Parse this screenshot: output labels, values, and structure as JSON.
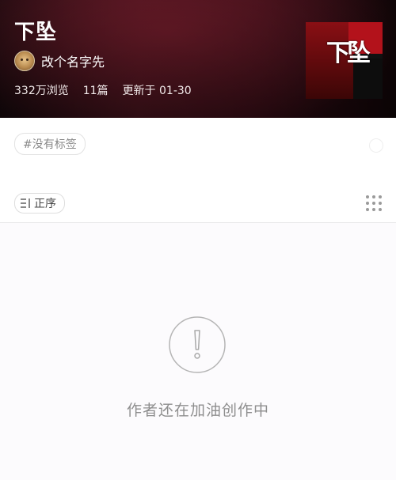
{
  "header": {
    "title": "下坠",
    "author": "改个名字先",
    "stats": {
      "views": "332万浏览",
      "chapters": "11篇",
      "updated": "更新于 01-30"
    },
    "cover_text": "下坠"
  },
  "tags": {
    "chip_label": "#没有标签"
  },
  "sort": {
    "label": "正序",
    "icon": "sort-ascending-icon"
  },
  "layout_toggle": {
    "icon": "grid-dots-icon"
  },
  "empty_state": {
    "icon": "exclamation-circle-icon",
    "message": "作者还在加油创作中"
  }
}
